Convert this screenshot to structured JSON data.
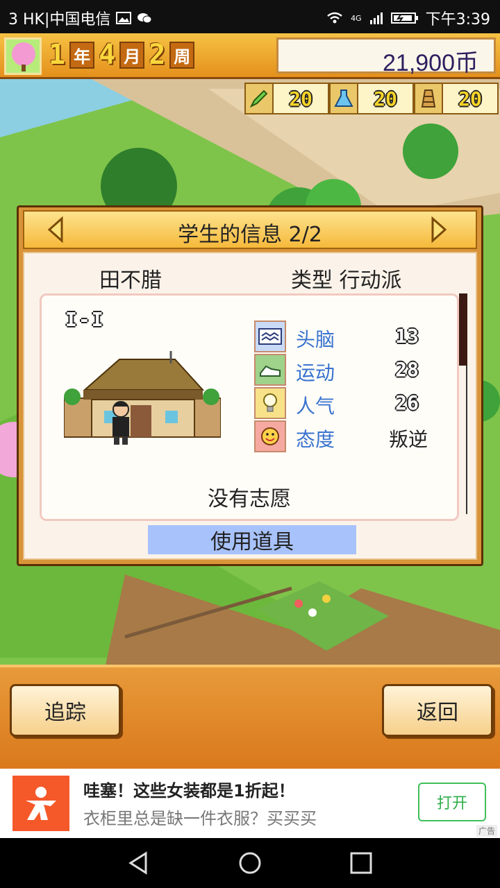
{
  "status_bar": {
    "carrier": "3 HK|中国电信",
    "network": "4G",
    "time": "下午3:39"
  },
  "hud": {
    "year_num": "1",
    "year_unit": "年",
    "month_num": "4",
    "month_unit": "月",
    "week_num": "2",
    "week_unit": "周",
    "money": "21,900币"
  },
  "resources": [
    {
      "icon": "pencil-icon",
      "value": "20"
    },
    {
      "icon": "flask-icon",
      "value": "20"
    },
    {
      "icon": "tower-icon",
      "value": "20"
    }
  ],
  "dialog": {
    "title": "学生的信息 2/2",
    "student_name": "田不腊",
    "type_label": "类型 行动派",
    "grade": "I-I",
    "stats": [
      {
        "icon": "brain-icon",
        "label": "头脑",
        "value": "13",
        "icon_bg": "#c9daf7"
      },
      {
        "icon": "shoe-icon",
        "label": "运动",
        "value": "28",
        "icon_bg": "#9fd28a"
      },
      {
        "icon": "lightbulb-icon",
        "label": "人气",
        "value": "26",
        "icon_bg": "#f7e28a"
      },
      {
        "icon": "smiley-icon",
        "label": "态度",
        "value": "叛逆",
        "icon_bg": "#f5a9a0"
      }
    ],
    "wish": "没有志愿",
    "use_item_button": "使用道具"
  },
  "bottom_menu": {
    "track_button": "追踪",
    "back_button": "返回"
  },
  "ad": {
    "title": "哇塞！这些女装都是1折起！",
    "subtitle": "衣柜里总是缺一件衣服？买买买",
    "open_button": "打开",
    "tag": "广告"
  }
}
